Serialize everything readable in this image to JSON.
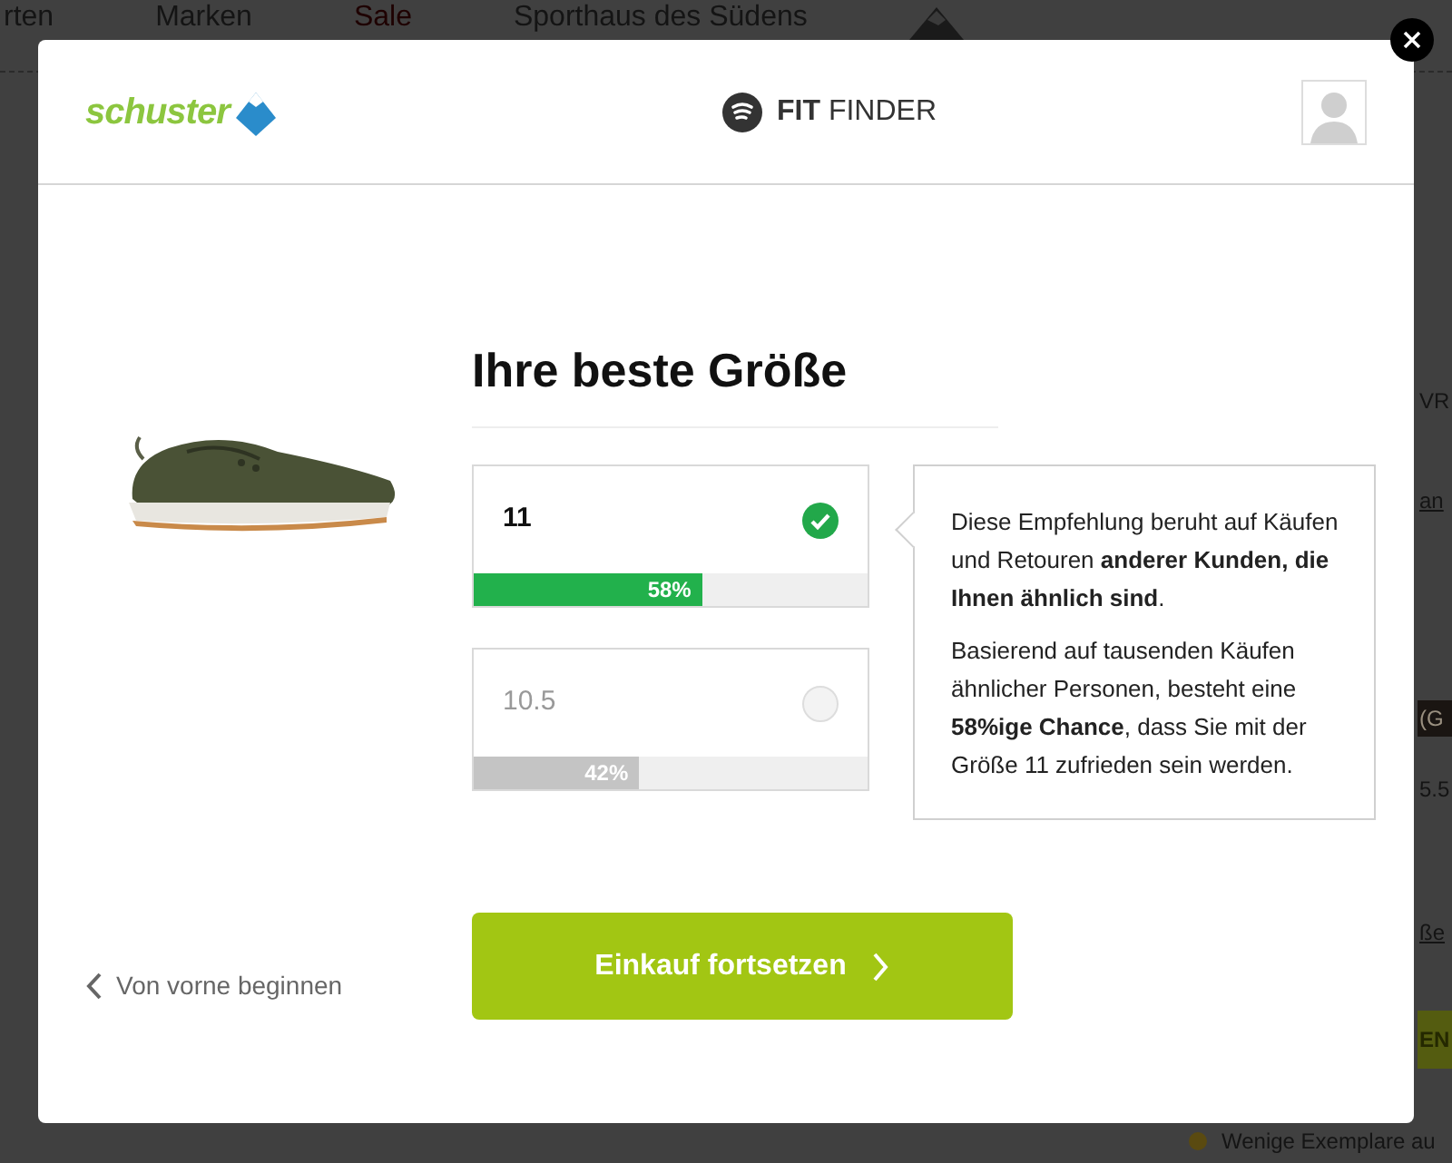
{
  "background_page": {
    "nav": [
      {
        "label": "rten",
        "highlighted": false
      },
      {
        "label": "Marken",
        "highlighted": false
      },
      {
        "label": "Sale",
        "highlighted": true
      },
      {
        "label": "Sporthaus des Südens",
        "highlighted": false
      }
    ],
    "side_fragments": [
      "VR",
      "an",
      "(G",
      "5.5",
      "ße",
      "EN"
    ],
    "bottom_fragments": [
      "Wenige Exemplare au"
    ]
  },
  "header": {
    "logo": "schuster",
    "product_bold": "FIT",
    "product_light": "FINDER"
  },
  "title": "Ihre beste Größe",
  "sizes": [
    {
      "label": "11",
      "selected": true,
      "level": 0.58,
      "percent": "58%"
    },
    {
      "label": "10.5",
      "selected": false,
      "level": 0.42,
      "percent": "42%"
    }
  ],
  "explanation": [
    "Diese Empfehlung beruht auf Käufen und Retouren **anderer Kunden, die Ihnen ähnlich sind**.",
    "Basierend auf tausenden Käufen ähnlicher Personen, besteht eine **58%ige Chance**, dass Sie mit der Größe 11 zufrieden sein werden."
  ],
  "back_link": "Von vorne beginnen",
  "continue_button": "Einkauf fortsetzen"
}
